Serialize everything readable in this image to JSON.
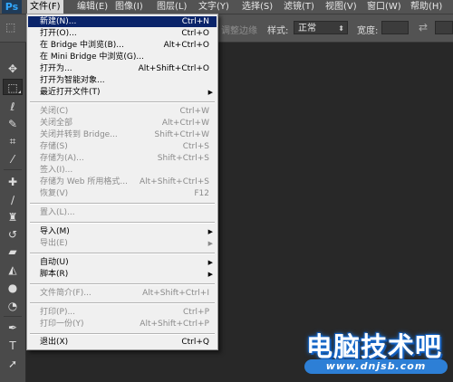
{
  "app": {
    "logo": "Ps"
  },
  "menubar": [
    {
      "label": "文件(F)",
      "active": true
    },
    {
      "label": "编辑(E)"
    },
    {
      "label": "图像(I)"
    },
    {
      "label": "图层(L)"
    },
    {
      "label": "文字(Y)"
    },
    {
      "label": "选择(S)"
    },
    {
      "label": "滤镜(T)"
    },
    {
      "label": "视图(V)"
    },
    {
      "label": "窗口(W)"
    },
    {
      "label": "帮助(H)"
    }
  ],
  "options": {
    "refine_edge": "调整边缘",
    "style_label": "样式:",
    "style_value": "正常",
    "width_label": "宽度:"
  },
  "file_menu": [
    {
      "label": "新建(N)...",
      "shortcut": "Ctrl+N",
      "highlighted": true
    },
    {
      "label": "打开(O)...",
      "shortcut": "Ctrl+O"
    },
    {
      "label": "在 Bridge 中浏览(B)...",
      "shortcut": "Alt+Ctrl+O"
    },
    {
      "label": "在 Mini Bridge 中浏览(G)..."
    },
    {
      "label": "打开为...",
      "shortcut": "Alt+Shift+Ctrl+O"
    },
    {
      "label": "打开为智能对象..."
    },
    {
      "label": "最近打开文件(T)",
      "submenu": true
    },
    {
      "separator": true
    },
    {
      "label": "关闭(C)",
      "shortcut": "Ctrl+W",
      "disabled": true
    },
    {
      "label": "关闭全部",
      "shortcut": "Alt+Ctrl+W",
      "disabled": true
    },
    {
      "label": "关闭并转到 Bridge...",
      "shortcut": "Shift+Ctrl+W",
      "disabled": true
    },
    {
      "label": "存储(S)",
      "shortcut": "Ctrl+S",
      "disabled": true
    },
    {
      "label": "存储为(A)...",
      "shortcut": "Shift+Ctrl+S",
      "disabled": true
    },
    {
      "label": "签入(I)...",
      "disabled": true
    },
    {
      "label": "存储为 Web 所用格式...",
      "shortcut": "Alt+Shift+Ctrl+S",
      "disabled": true
    },
    {
      "label": "恢复(V)",
      "shortcut": "F12",
      "disabled": true
    },
    {
      "separator": true
    },
    {
      "label": "置入(L)...",
      "disabled": true
    },
    {
      "separator": true
    },
    {
      "label": "导入(M)",
      "submenu": true
    },
    {
      "label": "导出(E)",
      "submenu": true,
      "disabled": true
    },
    {
      "separator": true
    },
    {
      "label": "自动(U)",
      "submenu": true
    },
    {
      "label": "脚本(R)",
      "submenu": true
    },
    {
      "separator": true
    },
    {
      "label": "文件简介(F)...",
      "shortcut": "Alt+Shift+Ctrl+I",
      "disabled": true
    },
    {
      "separator": true
    },
    {
      "label": "打印(P)...",
      "shortcut": "Ctrl+P",
      "disabled": true
    },
    {
      "label": "打印一份(Y)",
      "shortcut": "Alt+Shift+Ctrl+P",
      "disabled": true
    },
    {
      "separator": true
    },
    {
      "label": "退出(X)",
      "shortcut": "Ctrl+Q"
    }
  ],
  "watermark": {
    "title": "电脑技术吧",
    "url": "www.dnjsb.com"
  },
  "colors": {
    "menu_highlight": "#0a246a",
    "canvas_bg": "#282828"
  }
}
